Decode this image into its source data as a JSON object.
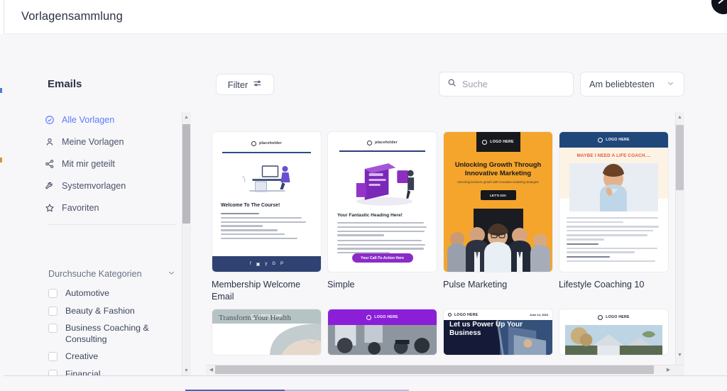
{
  "header": {
    "title": "Vorlagensammlung"
  },
  "sidebar": {
    "heading": "Emails",
    "nav_items": [
      {
        "label": "Alle Vorlagen",
        "icon": "check-circle-icon",
        "active": true
      },
      {
        "label": "Meine Vorlagen",
        "icon": "person-icon",
        "active": false
      },
      {
        "label": "Mit mir geteilt",
        "icon": "share-icon",
        "active": false
      },
      {
        "label": "Systemvorlagen",
        "icon": "wrench-icon",
        "active": false
      },
      {
        "label": "Favoriten",
        "icon": "star-icon",
        "active": false
      }
    ],
    "categories_header": "Durchsuche Kategorien",
    "categories": [
      {
        "label": "Automotive",
        "checked": false
      },
      {
        "label": "Beauty & Fashion",
        "checked": false
      },
      {
        "label": "Business Coaching & Consulting",
        "checked": false
      },
      {
        "label": "Creative",
        "checked": false
      },
      {
        "label": "Financial",
        "checked": false
      }
    ]
  },
  "toolbar": {
    "filter_label": "Filter",
    "filter_icon": "sliders-icon",
    "search_placeholder": "Suche",
    "search_value": "",
    "search_icon": "search-icon",
    "sort_value": "Am beliebtesten",
    "sort_icon": "chevron-down-icon"
  },
  "templates": [
    {
      "title": "Membership Welcome Email",
      "logo": "placeholder",
      "heading": "Welcome To The Course!",
      "body_lines": [
        "Hi {{contact_first_name}},",
        "Thanks for joining our {{membership_contact_offer_title}}!",
        "You can access the course here {{membership_contact_login_url}}",
        "With these credentials:",
        "Email: {{membership_contact_email}}",
        "Password: {{membership_contact_password}}",
        "Let us know if you need anything else, we're here to help!"
      ],
      "social_icons": [
        "facebook",
        "instagram",
        "twitter",
        "google",
        "pinterest"
      ]
    },
    {
      "title": "Simple",
      "logo": "placeholder",
      "heading": "Your Fantastic Heading Here!",
      "cta_label": "Your Call-To-Action Here"
    },
    {
      "title": "Pulse Marketing",
      "logo": "LOGO HERE",
      "heading": "Unlocking Growth Through Innovative Marketing",
      "subheading": "Unlocking business growth with innovative marketing strategies",
      "cta_label": "LET'S GO!"
    },
    {
      "title": "Lifestyle Coaching 10",
      "logo": "LOGO HERE",
      "heading": "MAYBE I NEED A LIFE COACH....",
      "body_intro": "Many people hire life coaches to help them identify the harmful patterns of living their causes."
    }
  ],
  "templates_row2": [
    {
      "logo": "LOGO HERE",
      "heading": "Transform Your Health"
    },
    {
      "logo": "LOGO HERE",
      "heading": ""
    },
    {
      "logo": "LOGO HERE",
      "heading": "Let us Power Up Your Business",
      "date": "June 14, 2023"
    },
    {
      "logo": "LOGO HERE",
      "heading": ""
    }
  ],
  "scrollbars": {
    "up_arrow": "▲",
    "down_arrow": "▼",
    "left_arrow": "◀",
    "right_arrow": "▶"
  }
}
